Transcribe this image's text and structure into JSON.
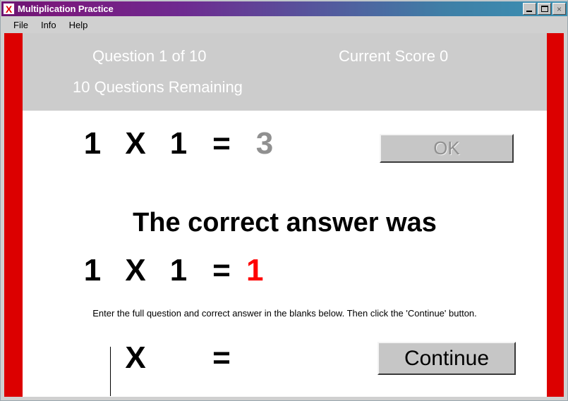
{
  "window": {
    "title": "Multiplication Practice",
    "app_icon": "multiplication-x-icon",
    "icon_glyph": "X",
    "controls": {
      "minimize_label": "Minimize",
      "maximize_label": "Maximize",
      "close_label": "×"
    }
  },
  "menubar": {
    "items": [
      {
        "label": "File"
      },
      {
        "label": "Info"
      },
      {
        "label": "Help"
      }
    ]
  },
  "status": {
    "question_progress": "Question 1 of 10",
    "current_score": "Current Score 0",
    "questions_remaining": "10 Questions Remaining"
  },
  "attempt_equation": {
    "operand_a": "1",
    "times_symbol": "X",
    "operand_b": "1",
    "equals_symbol": "=",
    "user_answer": "3"
  },
  "feedback": {
    "headline": "The correct answer was"
  },
  "correct_equation": {
    "operand_a": "1",
    "times_symbol": "X",
    "operand_b": "1",
    "equals_symbol": "=",
    "correct_answer": "1"
  },
  "instructions": {
    "text": "Enter the full question and correct answer in the blanks below.  Then click the 'Continue' button."
  },
  "answer_entry": {
    "operand_a_value": "",
    "operand_a_placeholder": "",
    "times_symbol": "X",
    "operand_b_value": "",
    "operand_b_placeholder": "",
    "equals_symbol": "=",
    "answer_value": "",
    "answer_placeholder": ""
  },
  "buttons": {
    "ok_label": "OK",
    "ok_enabled": false,
    "continue_label": "Continue",
    "continue_enabled": true
  },
  "colors": {
    "side_panel_red": "#dc0000",
    "correct_answer_red": "#ff0000",
    "wrong_answer_gray": "#909090",
    "header_gray": "#cccccc",
    "button_face": "#c6c6c6",
    "titlebar_left": "#6a1470",
    "titlebar_right": "#3a91b4"
  }
}
